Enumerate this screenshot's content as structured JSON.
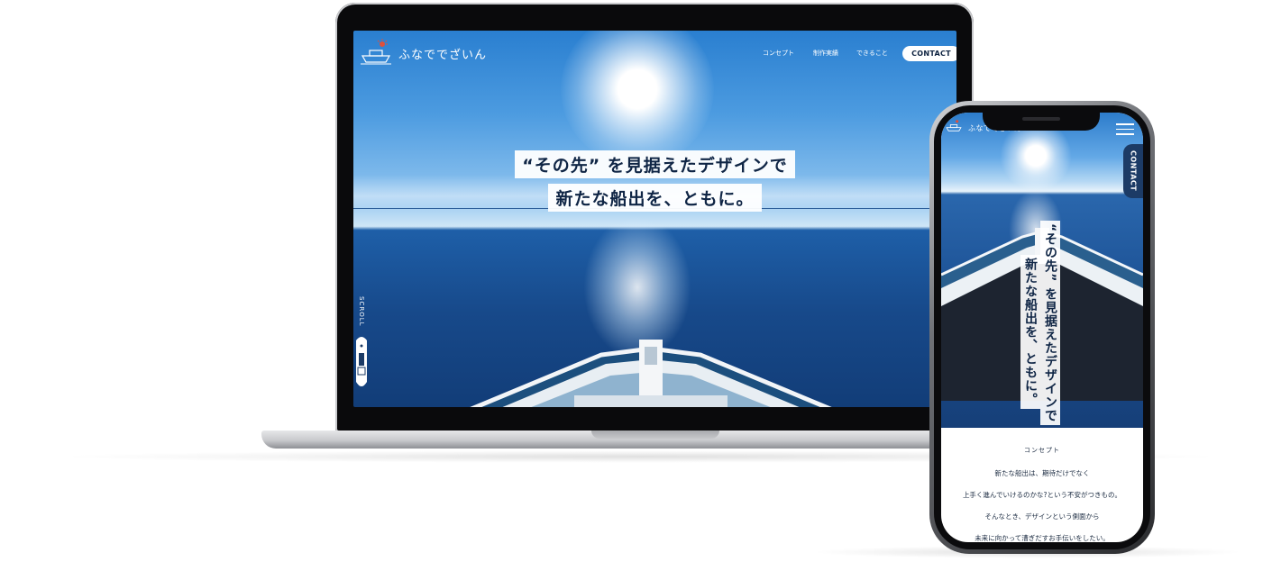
{
  "laptop": {
    "logo_text": "ふなででざいん",
    "nav": [
      "コンセプト",
      "制作実績",
      "できること"
    ],
    "contact_label": "CONTACT",
    "headline_line1": "“その先” を見据えたデザインで",
    "headline_line2": "新たな船出を、ともに。",
    "scroll_label": "SCROLL"
  },
  "phone": {
    "logo_text": "ふなででざいん",
    "contact_label": "CONTACT",
    "headline_col1": "“その先” を見据えたデザインで",
    "headline_col2": "新たな船出を、ともに。",
    "section_label": "コンセプト",
    "body_lines": [
      "新たな船出は、期待だけでなく",
      "上手く進んでいけるのかな?という不安がつきもの。",
      "そんなとき、デザインという側面から",
      "未来に向かって漕ぎだすお手伝いをしたい。"
    ]
  },
  "colors": {
    "navy_text": "#0f2545",
    "contact_tab": "#1c3b66",
    "sky": "#4c9be0",
    "sea": "#17498a"
  }
}
